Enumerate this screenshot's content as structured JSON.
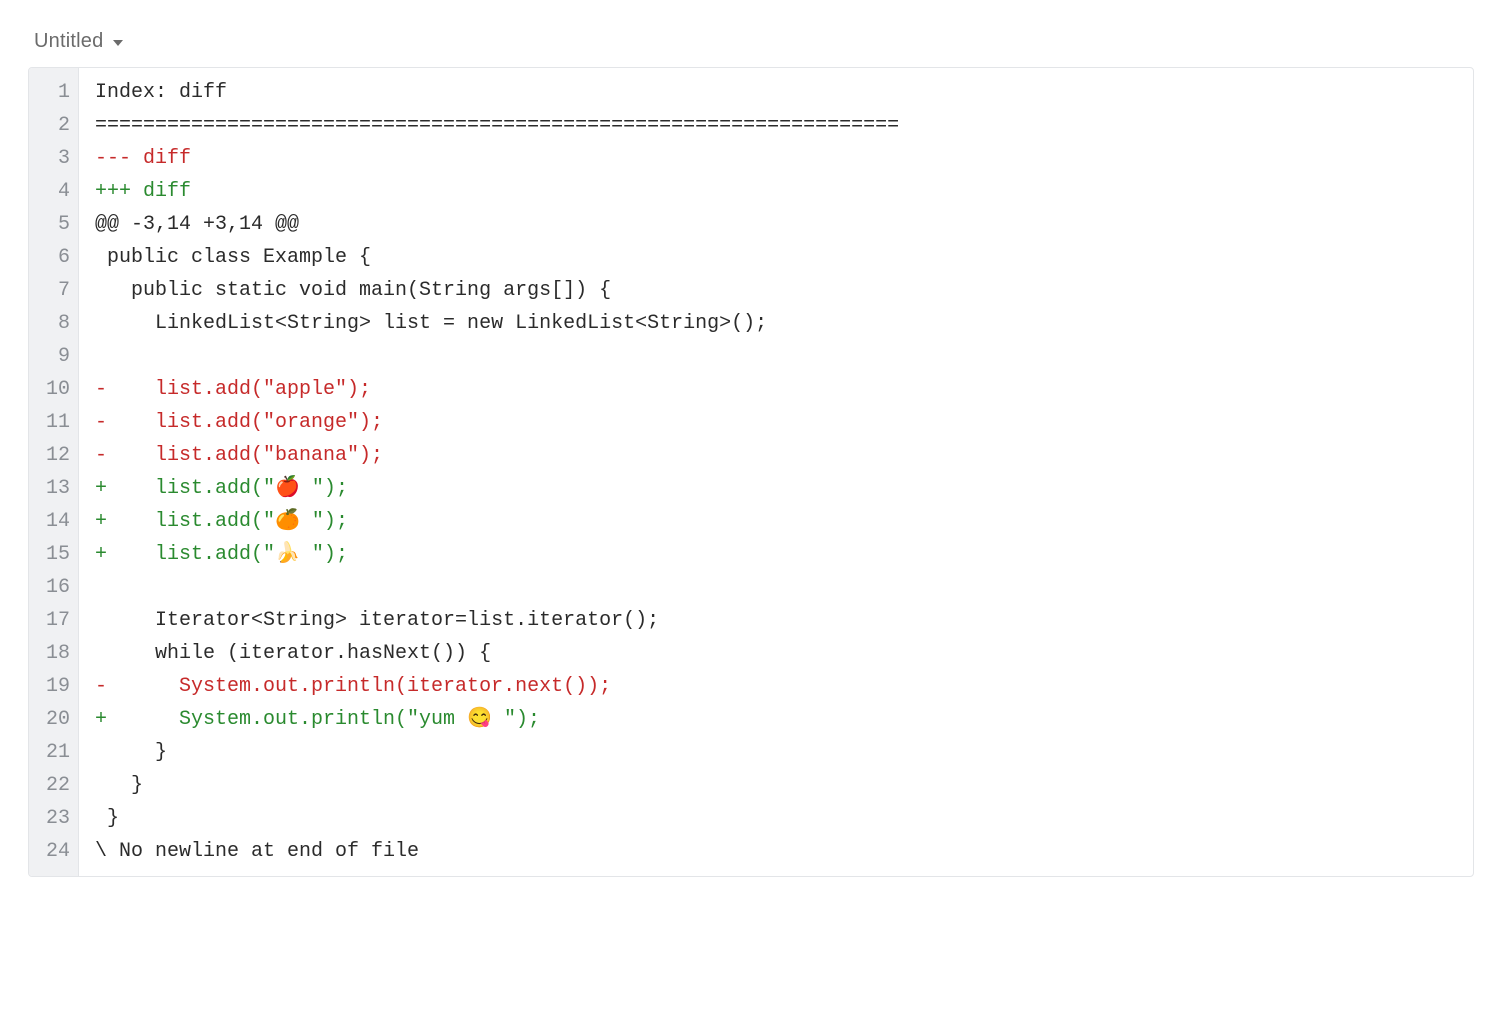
{
  "header": {
    "title": "Untitled"
  },
  "editor": {
    "lines": [
      {
        "n": 1,
        "cls": "diff-ctx",
        "text": "Index: diff"
      },
      {
        "n": 2,
        "cls": "diff-ctx",
        "text": "==================================================================="
      },
      {
        "n": 3,
        "cls": "diff-del",
        "text": "--- diff"
      },
      {
        "n": 4,
        "cls": "diff-add",
        "text": "+++ diff"
      },
      {
        "n": 5,
        "cls": "diff-ctx",
        "text": "@@ -3,14 +3,14 @@"
      },
      {
        "n": 6,
        "cls": "diff-ctx",
        "text": " public class Example {"
      },
      {
        "n": 7,
        "cls": "diff-ctx",
        "text": "   public static void main(String args[]) {"
      },
      {
        "n": 8,
        "cls": "diff-ctx",
        "text": "     LinkedList<String> list = new LinkedList<String>();"
      },
      {
        "n": 9,
        "cls": "diff-ctx",
        "text": " "
      },
      {
        "n": 10,
        "cls": "diff-del",
        "text": "-    list.add(\"apple\");"
      },
      {
        "n": 11,
        "cls": "diff-del",
        "text": "-    list.add(\"orange\");"
      },
      {
        "n": 12,
        "cls": "diff-del",
        "text": "-    list.add(\"banana\");"
      },
      {
        "n": 13,
        "cls": "diff-add",
        "text": "+    list.add(\"🍎 \");"
      },
      {
        "n": 14,
        "cls": "diff-add",
        "text": "+    list.add(\"🍊 \");"
      },
      {
        "n": 15,
        "cls": "diff-add",
        "text": "+    list.add(\"🍌 \");"
      },
      {
        "n": 16,
        "cls": "diff-ctx",
        "text": " "
      },
      {
        "n": 17,
        "cls": "diff-ctx",
        "text": "     Iterator<String> iterator=list.iterator();"
      },
      {
        "n": 18,
        "cls": "diff-ctx",
        "text": "     while (iterator.hasNext()) {"
      },
      {
        "n": 19,
        "cls": "diff-del",
        "text": "-      System.out.println(iterator.next());"
      },
      {
        "n": 20,
        "cls": "diff-add",
        "text": "+      System.out.println(\"yum 😋 \");"
      },
      {
        "n": 21,
        "cls": "diff-ctx",
        "text": "     }"
      },
      {
        "n": 22,
        "cls": "diff-ctx",
        "text": "   }"
      },
      {
        "n": 23,
        "cls": "diff-ctx",
        "text": " }"
      },
      {
        "n": 24,
        "cls": "diff-ctx",
        "text": "\\ No newline at end of file"
      }
    ]
  }
}
